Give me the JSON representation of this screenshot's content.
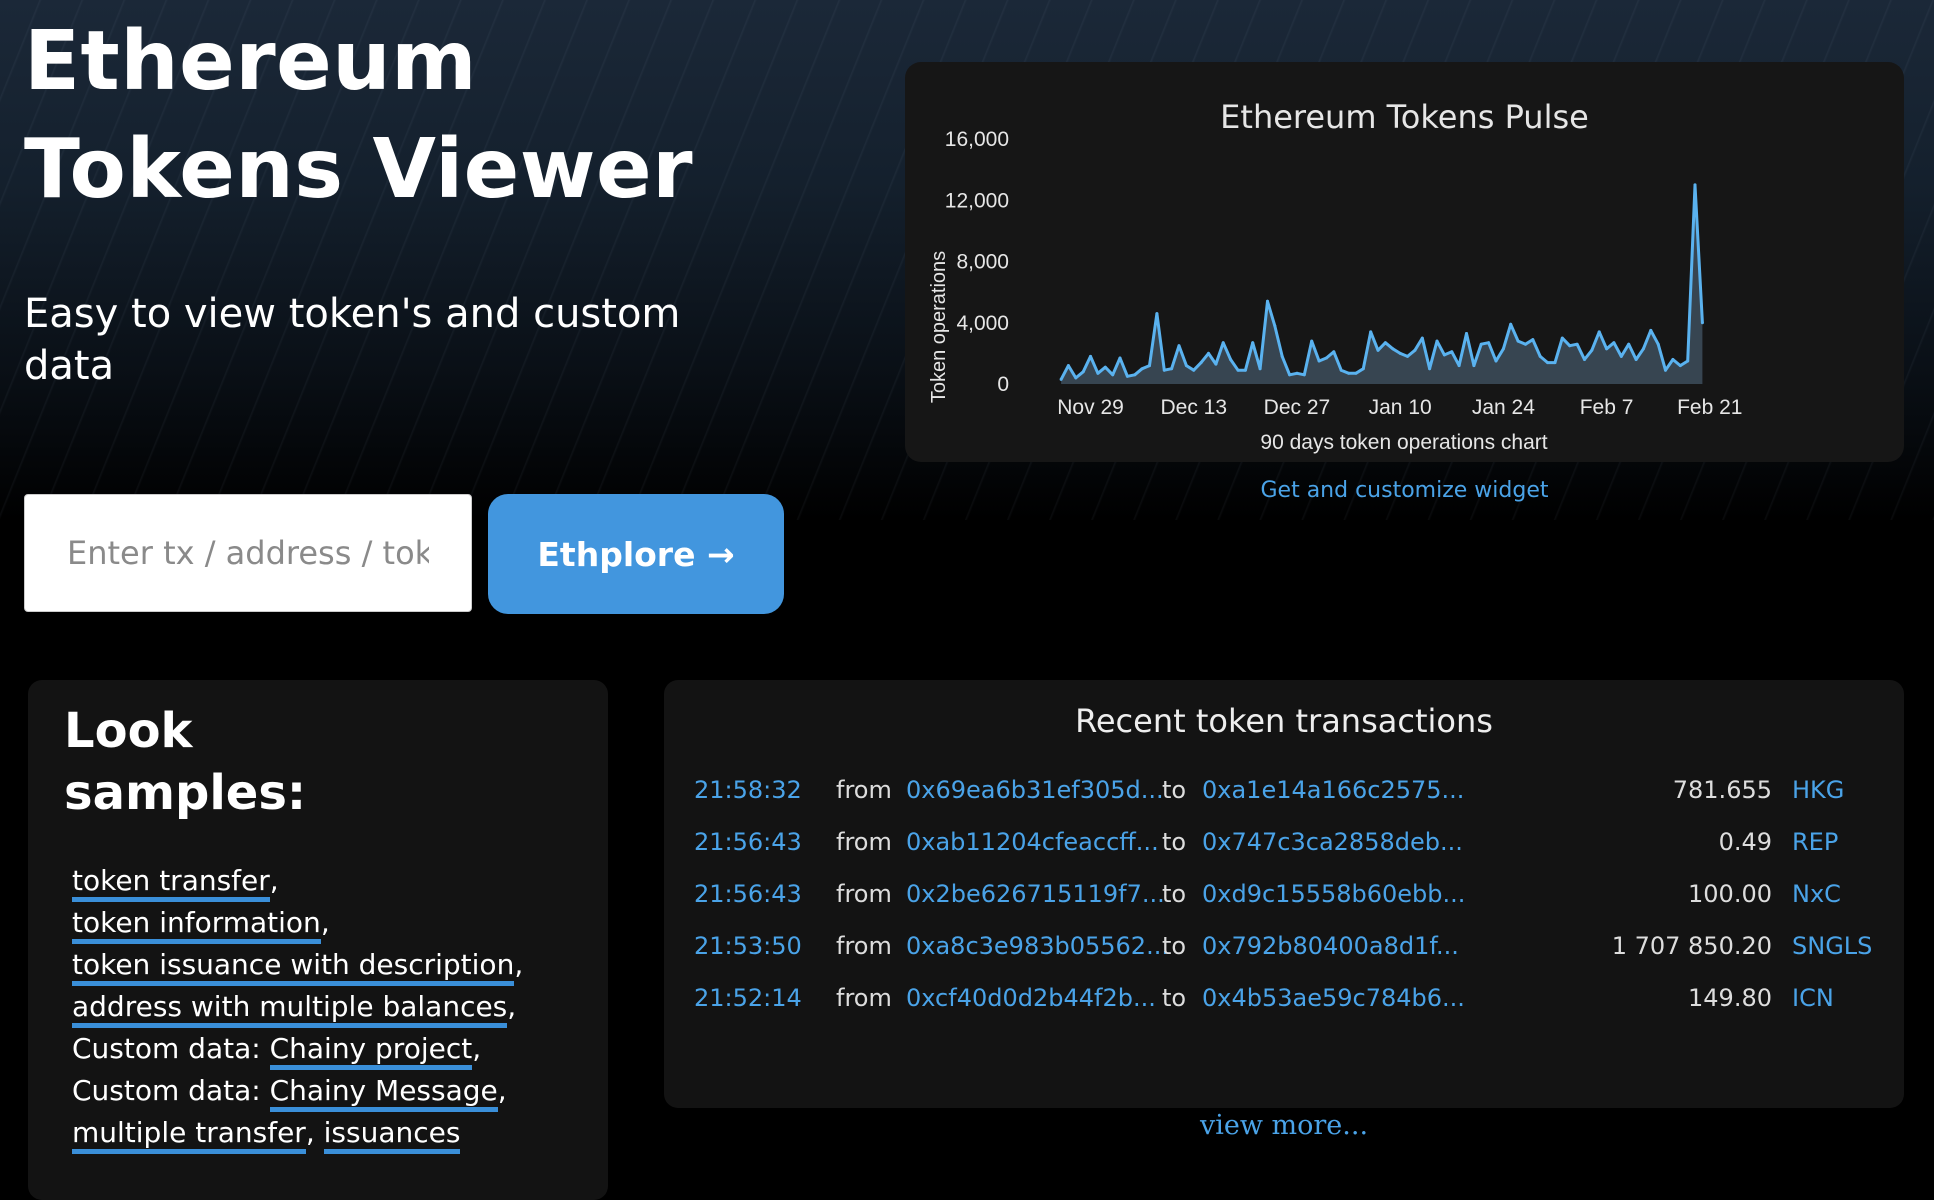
{
  "hero": {
    "title_line1": "Ethereum",
    "title_line2": "Tokens Viewer",
    "subtitle": "Easy to view token's and custom data"
  },
  "search": {
    "placeholder": "Enter tx / address / token",
    "button_label": "Ethplore →"
  },
  "widget": {
    "link_label": "Get and customize widget"
  },
  "chart_data": {
    "type": "area",
    "title": "Ethereum Tokens Pulse",
    "xlabel": "90 days token operations chart",
    "ylabel": "Token operations",
    "ylim": [
      0,
      16000
    ],
    "y_ticks": [
      "0",
      "4,000",
      "8,000",
      "12,000",
      "16,000"
    ],
    "x_ticks": [
      "Nov 29",
      "Dec 13",
      "Dec 27",
      "Jan 10",
      "Jan 24",
      "Feb 7",
      "Feb 21"
    ],
    "x_tick_days": [
      0,
      14,
      28,
      42,
      56,
      70,
      84
    ],
    "grid": false,
    "color": "#5ab2ef",
    "series": [
      {
        "x_start": "Nov 25",
        "values": [
          300,
          1200,
          400,
          800,
          1800,
          700,
          1100,
          600,
          1700,
          500,
          600,
          1000,
          1200,
          4600,
          900,
          1000,
          2500,
          1200,
          900,
          1400,
          2000,
          1300,
          2700,
          1600,
          900,
          900,
          2700,
          1000,
          5400,
          3800,
          1800,
          600,
          700,
          600,
          2800,
          1500,
          1700,
          2100,
          900,
          700,
          700,
          1000,
          3400,
          2200,
          2700,
          2300,
          2000,
          1800,
          2200,
          3000,
          1000,
          2800,
          1900,
          2100,
          1200,
          3300,
          1200,
          2600,
          2700,
          1500,
          2300,
          3900,
          2800,
          2600,
          2900,
          1800,
          1400,
          1400,
          3000,
          2500,
          2600,
          1600,
          2200,
          3400,
          2300,
          2700,
          1800,
          2600,
          1600,
          2300,
          3500,
          2600,
          900,
          1600,
          1200,
          1500,
          13000,
          4000
        ]
      }
    ]
  },
  "samples": {
    "heading_line1": "Look",
    "heading_line2": "samples:",
    "items": {
      "token_transfer": "token transfer",
      "token_information": "token information",
      "token_issuance": "token issuance with description",
      "address_balances": "address with multiple balances",
      "custom_prefix": "Custom data:",
      "chainy_project": "Chainy project",
      "chainy_message": "Chainy Message",
      "multiple_transfer": "multiple transfer",
      "issuances": "issuances"
    }
  },
  "transactions": {
    "title": "Recent token transactions",
    "from_label": "from",
    "to_label": "to",
    "rows": [
      {
        "time": "21:58:32",
        "from": "0x69ea6b31ef305d...",
        "to": "0xa1e14a166c2575...",
        "amount": "781.655",
        "token": "HKG"
      },
      {
        "time": "21:56:43",
        "from": "0xab11204cfeaccff...",
        "to": "0x747c3ca2858deb...",
        "amount": "0.49",
        "token": "REP"
      },
      {
        "time": "21:56:43",
        "from": "0x2be626715119f7...",
        "to": "0xd9c15558b60ebb...",
        "amount": "100.00",
        "token": "NxC"
      },
      {
        "time": "21:53:50",
        "from": "0xa8c3e983b05562...",
        "to": "0x792b80400a8d1f...",
        "amount": "1 707 850.20",
        "token": "SNGLS"
      },
      {
        "time": "21:52:14",
        "from": "0xcf40d0d2b44f2b...",
        "to": "0x4b53ae59c784b6...",
        "amount": "149.80",
        "token": "ICN"
      }
    ],
    "view_more": "view more..."
  }
}
